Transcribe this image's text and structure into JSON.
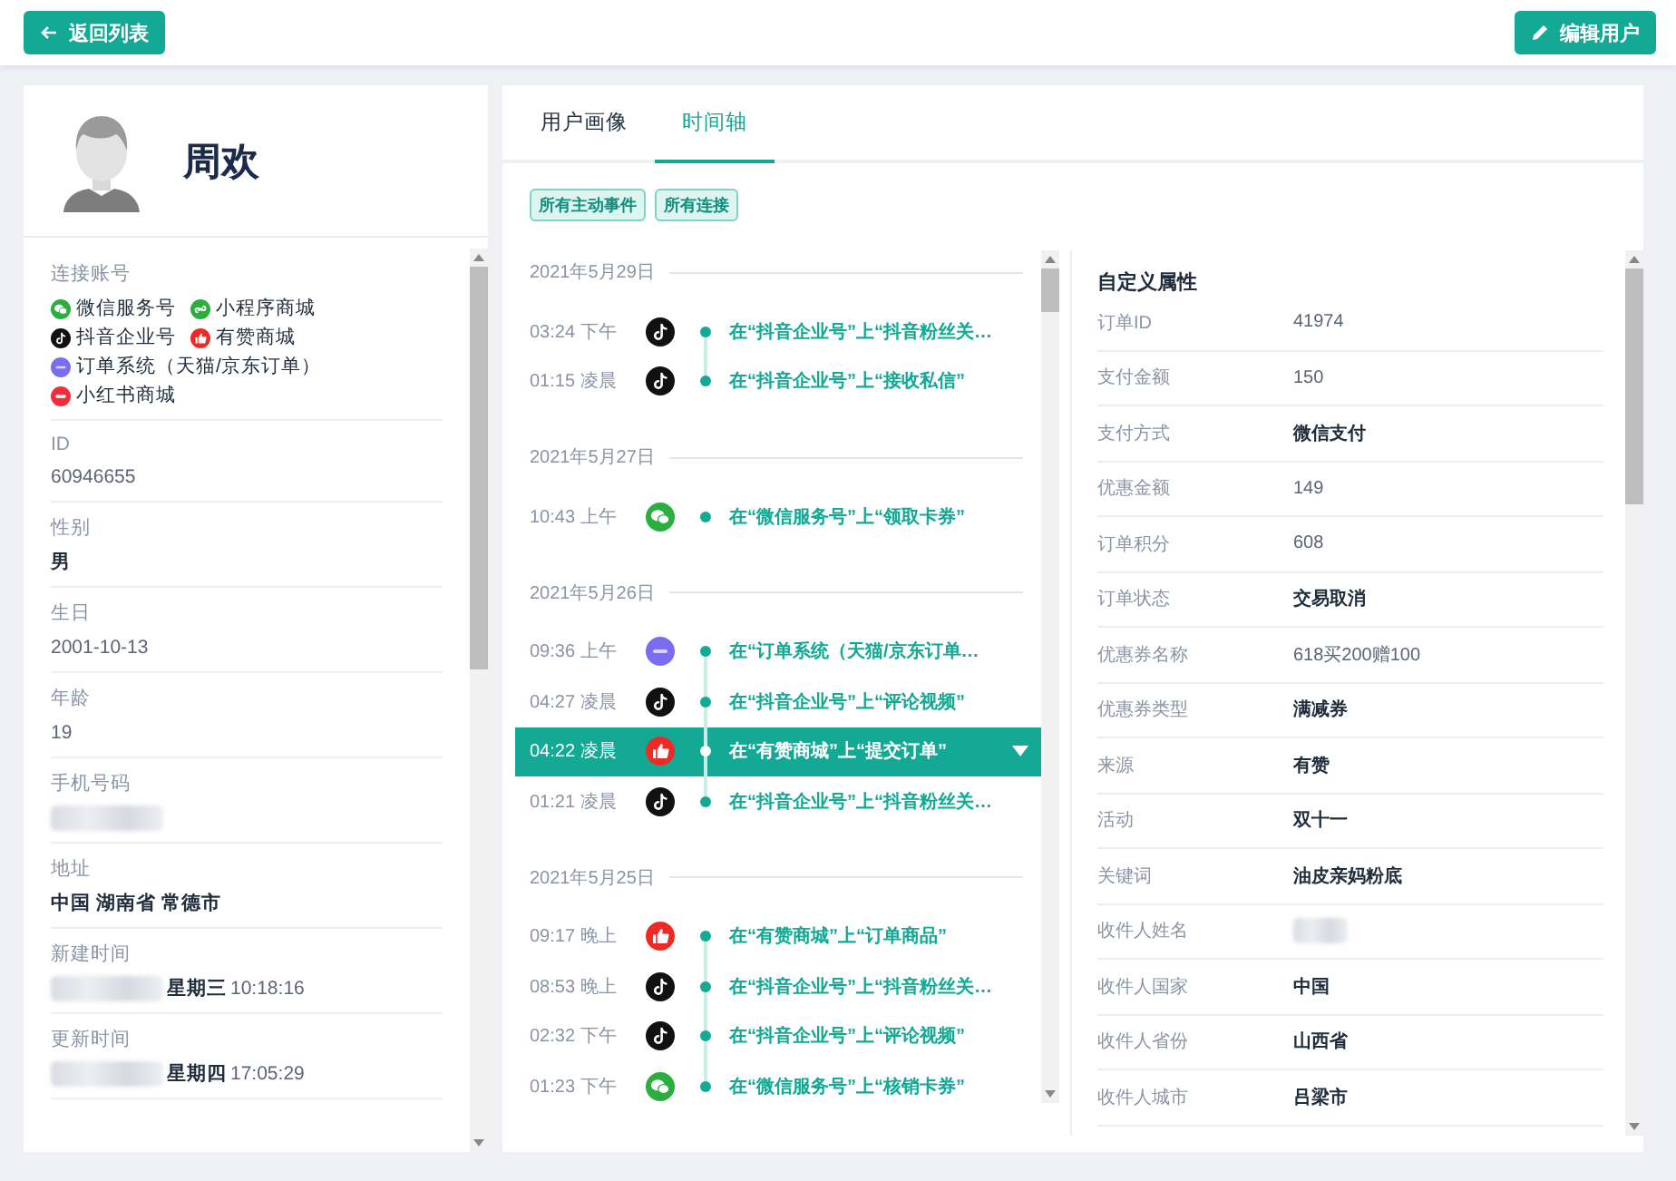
{
  "toolbar": {
    "back_button": "返回列表",
    "edit_button": "编辑用户"
  },
  "profile": {
    "name": "周欢",
    "accounts_label": "连接账号",
    "accounts": [
      {
        "kind": "wechat",
        "label": "微信服务号"
      },
      {
        "kind": "miniprogram",
        "label": "小程序商城"
      },
      {
        "kind": "douyin",
        "label": "抖音企业号"
      },
      {
        "kind": "youzan",
        "label": "有赞商城"
      },
      {
        "kind": "oms",
        "label": "订单系统（天猫/京东订单）"
      },
      {
        "kind": "xiaohongshu",
        "label": "小红书商城"
      }
    ],
    "fields": [
      {
        "label": "ID",
        "value": "60946655",
        "bold": false,
        "redacted": false
      },
      {
        "label": "性别",
        "value": "男",
        "bold": true,
        "redacted": false
      },
      {
        "label": "生日",
        "value": "2001-10-13",
        "bold": false,
        "redacted": false
      },
      {
        "label": "年龄",
        "value": "19",
        "bold": false,
        "redacted": false
      },
      {
        "label": "手机号码",
        "redacted": true,
        "bold": false
      },
      {
        "label": "地址",
        "value": "中国 湖南省 常德市",
        "bold": true,
        "redacted": false
      },
      {
        "label": "新建时间",
        "redacted": true,
        "weekday": "星期三",
        "value": "10:18:16",
        "bold": false
      },
      {
        "label": "更新时间",
        "redacted": true,
        "weekday": "星期四",
        "value": "17:05:29",
        "bold": false
      }
    ]
  },
  "tabs": [
    {
      "label": "用户画像",
      "selected": false
    },
    {
      "label": "时间轴",
      "selected": true
    }
  ],
  "filters": [
    "所有主动事件",
    "所有连接"
  ],
  "timeline": [
    {
      "date": "2021年5月29日",
      "events": [
        {
          "time": "03:24",
          "period": "下午",
          "kind": "douyin",
          "text": "在“抖音企业号”上“抖音粉丝关…",
          "selected": false
        },
        {
          "time": "01:15",
          "period": "凌晨",
          "kind": "douyin",
          "text": "在“抖音企业号”上“接收私信”",
          "selected": false
        }
      ]
    },
    {
      "date": "2021年5月27日",
      "events": [
        {
          "time": "10:43",
          "period": "上午",
          "kind": "wechat",
          "text": "在“微信服务号”上“领取卡券”",
          "selected": false
        }
      ]
    },
    {
      "date": "2021年5月26日",
      "events": [
        {
          "time": "09:36",
          "period": "上午",
          "kind": "oms",
          "text": "在“订单系统（天猫/京东订单…",
          "selected": false
        },
        {
          "time": "04:27",
          "period": "凌晨",
          "kind": "douyin",
          "text": "在“抖音企业号”上“评论视频”",
          "selected": false
        },
        {
          "time": "04:22",
          "period": "凌晨",
          "kind": "youzan",
          "text": "在“有赞商城”上“提交订单”",
          "selected": true
        },
        {
          "time": "01:21",
          "period": "凌晨",
          "kind": "douyin",
          "text": "在“抖音企业号”上“抖音粉丝关…",
          "selected": false
        }
      ]
    },
    {
      "date": "2021年5月25日",
      "events": [
        {
          "time": "09:17",
          "period": "晚上",
          "kind": "youzan",
          "text": "在“有赞商城”上“订单商品”",
          "selected": false
        },
        {
          "time": "08:53",
          "period": "晚上",
          "kind": "douyin",
          "text": "在“抖音企业号”上“抖音粉丝关…",
          "selected": false
        },
        {
          "time": "02:32",
          "period": "下午",
          "kind": "douyin",
          "text": "在“抖音企业号”上“评论视频”",
          "selected": false
        },
        {
          "time": "01:23",
          "period": "下午",
          "kind": "wechat",
          "text": "在“微信服务号”上“核销卡券”",
          "selected": false
        }
      ]
    }
  ],
  "details": {
    "title": "自定义属性",
    "rows": [
      {
        "label": "订单ID",
        "value": "41974",
        "bold": false,
        "redacted": false
      },
      {
        "label": "支付金额",
        "value": "150",
        "bold": false,
        "redacted": false
      },
      {
        "label": "支付方式",
        "value": "微信支付",
        "bold": true,
        "redacted": false
      },
      {
        "label": "优惠金额",
        "value": "149",
        "bold": false,
        "redacted": false
      },
      {
        "label": "订单积分",
        "value": "608",
        "bold": false,
        "redacted": false
      },
      {
        "label": "订单状态",
        "value": "交易取消",
        "bold": true,
        "redacted": false
      },
      {
        "label": "优惠券名称",
        "value": "618买200赠100",
        "bold": false,
        "redacted": false
      },
      {
        "label": "优惠券类型",
        "value": "满减券",
        "bold": true,
        "redacted": false
      },
      {
        "label": "来源",
        "value": "有赞",
        "bold": true,
        "redacted": false
      },
      {
        "label": "活动",
        "value": "双十一",
        "bold": true,
        "redacted": false
      },
      {
        "label": "关键词",
        "value": "油皮亲妈粉底",
        "bold": true,
        "redacted": false
      },
      {
        "label": "收件人姓名",
        "redacted": true,
        "bold": false
      },
      {
        "label": "收件人国家",
        "value": "中国",
        "bold": true,
        "redacted": false
      },
      {
        "label": "收件人省份",
        "value": "山西省",
        "bold": true,
        "redacted": false
      },
      {
        "label": "收件人城市",
        "value": "吕梁市",
        "bold": true,
        "redacted": false
      }
    ]
  }
}
